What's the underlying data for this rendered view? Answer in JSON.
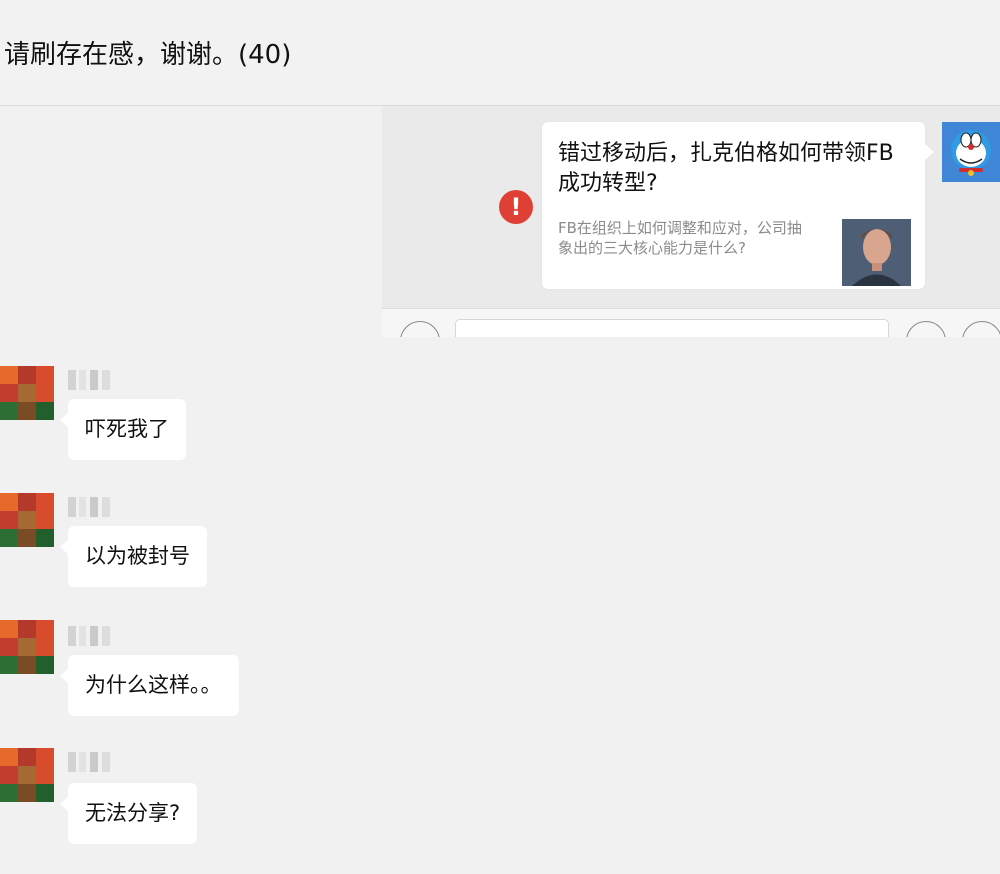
{
  "header": {
    "title": "请刷存在感，谢谢。(40)"
  },
  "share_panel": {
    "card": {
      "title": "错过移动后，扎克伯格如何带领FB成功转型?",
      "description": "FB在组织上如何调整和应对，公司抽象出的三大核心能力是什么?"
    },
    "failed_badge": "!"
  },
  "messages": [
    {
      "text": "吓死我了"
    },
    {
      "text": "以为被封号"
    },
    {
      "text": "为什么这样。。"
    },
    {
      "text": "无法分享?"
    }
  ],
  "colors": {
    "background": "#f2f1f2",
    "bubble": "#ffffff",
    "error_red": "#df4036",
    "avatar_blue": "#3f86d6"
  }
}
